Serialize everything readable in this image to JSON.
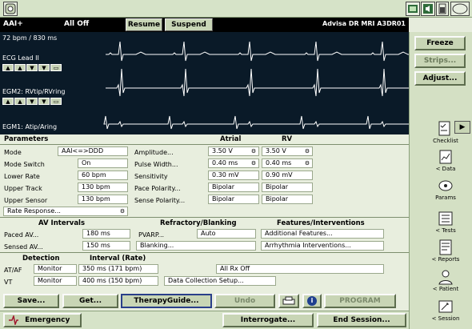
{
  "header": {
    "device_model": "Advisa DR MRI A3DR01",
    "mode": "AAI+",
    "status": "All Off",
    "resume_label": "Resume",
    "suspend_label": "Suspend",
    "rate_readout": "72 bpm / 830 ms"
  },
  "traces": {
    "ecg_label": "ECG Lead II",
    "egm2_label": "EGM2: RVtip/RVring",
    "egm1_label": "EGM1: Atip/Aring",
    "trace_color": "#ffffff",
    "background": "#0a1a28"
  },
  "sidebar": {
    "freeze_label": "Freeze",
    "strips_label": "Strips...",
    "adjust_label": "Adjust...",
    "expand_glyph": "▶",
    "nav": [
      {
        "label": "Checklist",
        "icon": "checklist-icon"
      },
      {
        "label": "< Data",
        "icon": "data-icon"
      },
      {
        "label": "Params",
        "icon": "params-icon"
      },
      {
        "label": "< Tests",
        "icon": "tests-icon"
      },
      {
        "label": "< Reports",
        "icon": "reports-icon"
      },
      {
        "label": "< Patient",
        "icon": "patient-icon"
      },
      {
        "label": "< Session",
        "icon": "session-icon"
      }
    ]
  },
  "params": {
    "title": "Parameters",
    "atrial_header": "Atrial",
    "rv_header": "RV",
    "mode_label": "Mode",
    "mode_value": "AAI<=>DDD",
    "mode_switch_label": "Mode Switch",
    "mode_switch_value": "On",
    "lower_rate_label": "Lower Rate",
    "lower_rate_value": "60 bpm",
    "upper_track_label": "Upper Track",
    "upper_track_value": "130 bpm",
    "upper_sensor_label": "Upper Sensor",
    "upper_sensor_value": "130 bpm",
    "rate_response_label": "Rate Response...",
    "amplitude_label": "Amplitude...",
    "amplitude_atrial": "3.50 V",
    "amplitude_rv": "3.50 V",
    "pulse_width_label": "Pulse Width...",
    "pulse_width_atrial": "0.40 ms",
    "pulse_width_rv": "0.40 ms",
    "sensitivity_label": "Sensitivity",
    "sensitivity_atrial": "0.30 mV",
    "sensitivity_rv": "0.90 mV",
    "pace_polarity_label": "Pace Polarity...",
    "pace_polarity_atrial": "Bipolar",
    "pace_polarity_rv": "Bipolar",
    "sense_polarity_label": "Sense Polarity...",
    "sense_polarity_atrial": "Bipolar",
    "sense_polarity_rv": "Bipolar",
    "av_intervals_header": "AV Intervals",
    "paced_av_label": "Paced AV...",
    "paced_av_value": "180 ms",
    "sensed_av_label": "Sensed AV...",
    "sensed_av_value": "150 ms",
    "refractory_header": "Refractory/Blanking",
    "pvarp_label": "PVARP...",
    "pvarp_value": "Auto",
    "blanking_label": "Blanking...",
    "features_header": "Features/Interventions",
    "additional_features_label": "Additional Features...",
    "arrhythmia_label": "Arrhythmia Interventions...",
    "detection_header": "Detection",
    "interval_header": "Interval (Rate)",
    "at_af_label": "AT/AF",
    "at_af_detection": "Monitor",
    "at_af_interval": "350 ms (171 bpm)",
    "vt_label": "VT",
    "vt_detection": "Monitor",
    "vt_interval": "400 ms (150 bpm)",
    "all_rx_off": "All Rx Off",
    "data_collection_label": "Data Collection Setup...",
    "icon_glyph": "⚙"
  },
  "actions": {
    "save_label": "Save...",
    "get_label": "Get...",
    "therapy_guide_label": "TherapyGuide...",
    "undo_label": "Undo",
    "info_glyph": "i",
    "program_label": "PROGRAM"
  },
  "footer": {
    "emergency_label": "Emergency",
    "interrogate_label": "Interrogate...",
    "end_session_label": "End Session..."
  },
  "controls": {
    "up": "▲",
    "down": "▼",
    "cal": "▭"
  }
}
